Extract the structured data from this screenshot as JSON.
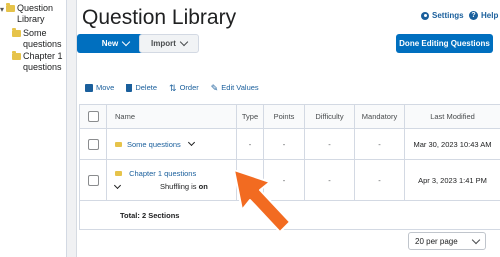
{
  "tree": {
    "root": {
      "label": "Question Library"
    },
    "children": [
      {
        "label": "Some questions"
      },
      {
        "label": "Chapter 1 questions"
      }
    ]
  },
  "header": {
    "title": "Question Library",
    "settings": "Settings",
    "help": "Help"
  },
  "actions": {
    "new": "New",
    "import": "Import",
    "done": "Done Editing Questions"
  },
  "toolbar": {
    "move": "Move",
    "delete": "Delete",
    "order": "Order",
    "edit_values": "Edit Values"
  },
  "table": {
    "columns": [
      "Name",
      "Type",
      "Points",
      "Difficulty",
      "Mandatory",
      "Last Modified"
    ],
    "rows": [
      {
        "name": "Some questions",
        "type": "-",
        "points": "-",
        "difficulty": "-",
        "mandatory": "-",
        "modified": "Mar 30, 2023 10:43 AM"
      },
      {
        "name": "Chapter 1 questions",
        "shuffle_prefix": "Shuffling is",
        "shuffle_state": "on",
        "type": "-",
        "points": "-",
        "difficulty": "-",
        "mandatory": "-",
        "modified": "Apr 3, 2023 1:41 PM"
      }
    ],
    "total": "Total: 2 Sections"
  },
  "pager": {
    "value": "20 per page"
  },
  "colors": {
    "primary": "#006fbf",
    "link": "#1a5f9c",
    "arrow": "#f26b21"
  }
}
